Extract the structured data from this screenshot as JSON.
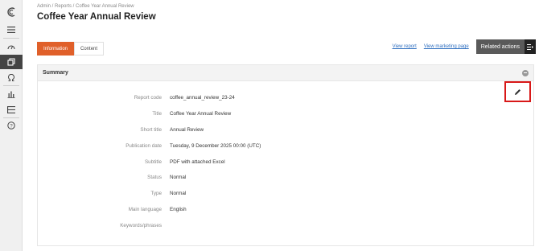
{
  "breadcrumb": "Admin / Reports / Coffee Year Annual Review",
  "page_title": "Coffee Year Annual Review",
  "tabs": [
    {
      "label": "Information",
      "active": true
    },
    {
      "label": "Content",
      "active": false
    }
  ],
  "links": {
    "view_report": "View report",
    "view_marketing_page": "View marketing page"
  },
  "related_actions": "Related actions",
  "summary": {
    "title": "Summary",
    "fields": [
      {
        "label": "Report code",
        "value": "coffee_annual_review_23-24"
      },
      {
        "label": "Title",
        "value": "Coffee Year Annual Review"
      },
      {
        "label": "Short title",
        "value": "Annual Review"
      },
      {
        "label": "Publication date",
        "value": "Tuesday, 9 December 2025 00:00 (UTC)"
      },
      {
        "label": "Subtitle",
        "value": "PDF with attached Excel"
      },
      {
        "label": "Status",
        "value": "Normal"
      },
      {
        "label": "Type",
        "value": "Normal"
      },
      {
        "label": "Main language",
        "value": "English"
      },
      {
        "label": "Keywords/phrases",
        "value": ""
      }
    ]
  },
  "colors": {
    "accent": "#e0602a",
    "link": "#2f6fc0",
    "highlight": "#d81818"
  },
  "sidebar_icons": [
    "logo-icon",
    "menu-icon",
    "dashboard-icon",
    "reports-icon",
    "omega-icon",
    "chart-icon",
    "list-icon",
    "help-icon"
  ]
}
